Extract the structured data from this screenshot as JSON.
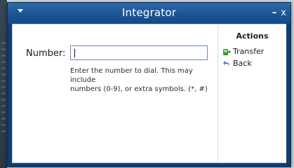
{
  "window": {
    "title": "Integrator",
    "minimize_glyph": "–",
    "close_glyph": "x"
  },
  "form": {
    "number_label": "Number:",
    "number_value": "",
    "help_text": "Enter the number to dial. This may include\nnumbers (0-9), or extra symbols. (*, #)"
  },
  "actions": {
    "title": "Actions",
    "items": [
      {
        "label": "Transfer",
        "icon": "transfer-phone-icon"
      },
      {
        "label": "Back",
        "icon": "back-arrow-icon"
      }
    ]
  },
  "colors": {
    "titlebar": "#1c5594",
    "window_frame": "#0f3d72",
    "input_border": "#6a8ab3",
    "transfer_icon_green": "#3f9a2f",
    "back_icon_blue": "#3a7bd5"
  }
}
